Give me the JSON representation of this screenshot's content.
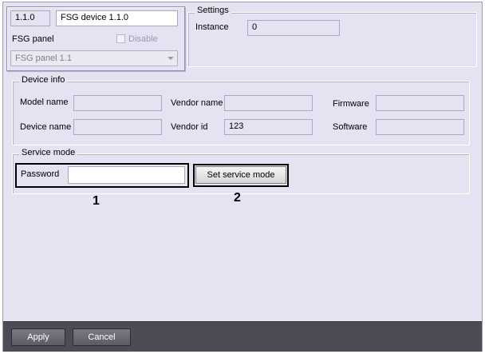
{
  "device": {
    "address": "1.1.0",
    "name": "FSG device 1.1.0",
    "panel_label": "FSG panel",
    "disable_label": "Disable",
    "panel_selected": "FSG panel 1.1"
  },
  "settings": {
    "title": "Settings",
    "instance_label": "Instance",
    "instance_value": "0"
  },
  "device_info": {
    "title": "Device info",
    "model_name_label": "Model name",
    "model_name_value": "",
    "vendor_name_label": "Vendor name",
    "vendor_name_value": "",
    "firmware_label": "Firmware",
    "firmware_value": "",
    "device_name_label": "Device name",
    "device_name_value": "",
    "vendor_id_label": "Vendor id",
    "vendor_id_value": "123",
    "software_label": "Software",
    "software_value": ""
  },
  "service_mode": {
    "title": "Service mode",
    "password_label": "Password",
    "password_value": "",
    "set_button": "Set service mode"
  },
  "callouts": {
    "one": "1",
    "two": "2"
  },
  "footer": {
    "apply": "Apply",
    "cancel": "Cancel"
  }
}
